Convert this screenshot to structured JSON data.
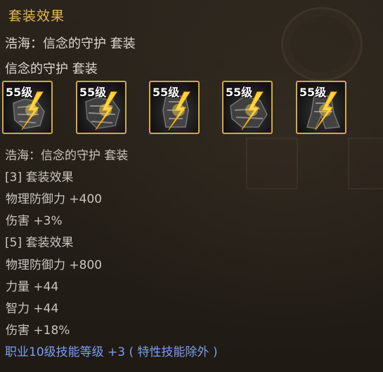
{
  "tooltip": {
    "title": "套装效果",
    "set_full_name": "浩海：信念的守护 套装",
    "set_name": "信念的守护 套装",
    "items": [
      {
        "level": "55级",
        "icon": "armor-piece-icon"
      },
      {
        "level": "55级",
        "icon": "armor-piece-icon"
      },
      {
        "level": "55级",
        "icon": "armor-piece-icon"
      },
      {
        "level": "55级",
        "icon": "armor-piece-icon"
      },
      {
        "level": "55级",
        "icon": "armor-piece-icon"
      }
    ],
    "detail_set_name": "浩海：信念的守护 套装",
    "tier3_header": "[3] 套装效果",
    "tier3_stats": [
      "物理防御力 +400",
      "伤害 +3%"
    ],
    "tier5_header": "[5] 套装效果",
    "tier5_stats": [
      "物理防御力 +800",
      "力量 +44",
      "智力 +44",
      "伤害 +18%"
    ],
    "special_bonus": "职业10级技能等级 +3 ( 特性技能除外 )",
    "colors": {
      "title": "#e3b85a",
      "text": "#cbc6bc",
      "bonus": "#7a9ef0",
      "slot_border": "#d4a93a"
    }
  }
}
